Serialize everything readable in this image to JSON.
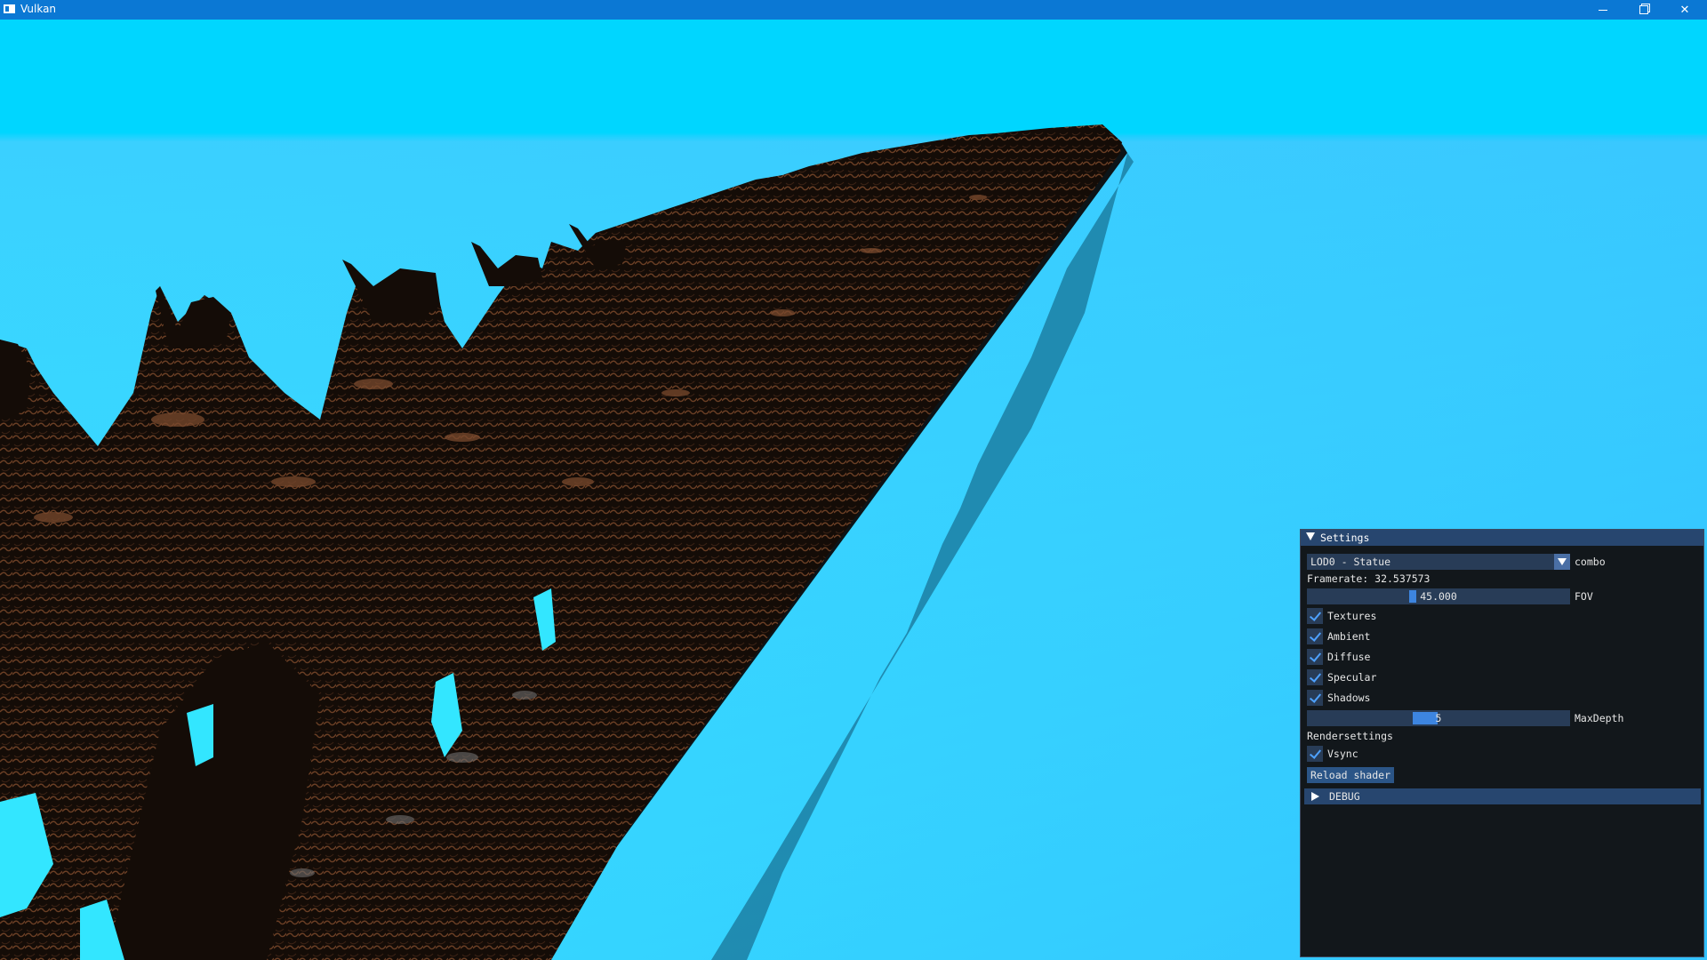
{
  "window": {
    "title": "Vulkan",
    "controls": [
      "minimize-icon",
      "restore-icon",
      "close-icon"
    ]
  },
  "scene": {
    "sky_color": "#00c8f5",
    "horizon_color": "#39b6ff",
    "silhouette_color": "#140d08",
    "highlight_color": "#7a4a2e",
    "shadow_color": "#1b84a8"
  },
  "settings": {
    "title": "Settings",
    "lod_value": "LOD0 - Statue",
    "lod_label": "combo",
    "framerate": "Framerate: 32.537573",
    "fov_value": "45.000",
    "fov_label": "FOV",
    "fov_fraction": 0.4,
    "checkboxes": [
      {
        "label": "Textures",
        "checked": true
      },
      {
        "label": "Ambient",
        "checked": true
      },
      {
        "label": "Diffuse",
        "checked": true
      },
      {
        "label": "Specular",
        "checked": true
      },
      {
        "label": "Shadows",
        "checked": true
      }
    ],
    "maxdepth_value": "5",
    "maxdepth_label": "MaxDepth",
    "rendersettings_label": "Rendersettings",
    "vsync_label": "Vsync",
    "vsync_checked": true,
    "reload_button": "Reload shader",
    "debug_label": "DEBUG"
  }
}
